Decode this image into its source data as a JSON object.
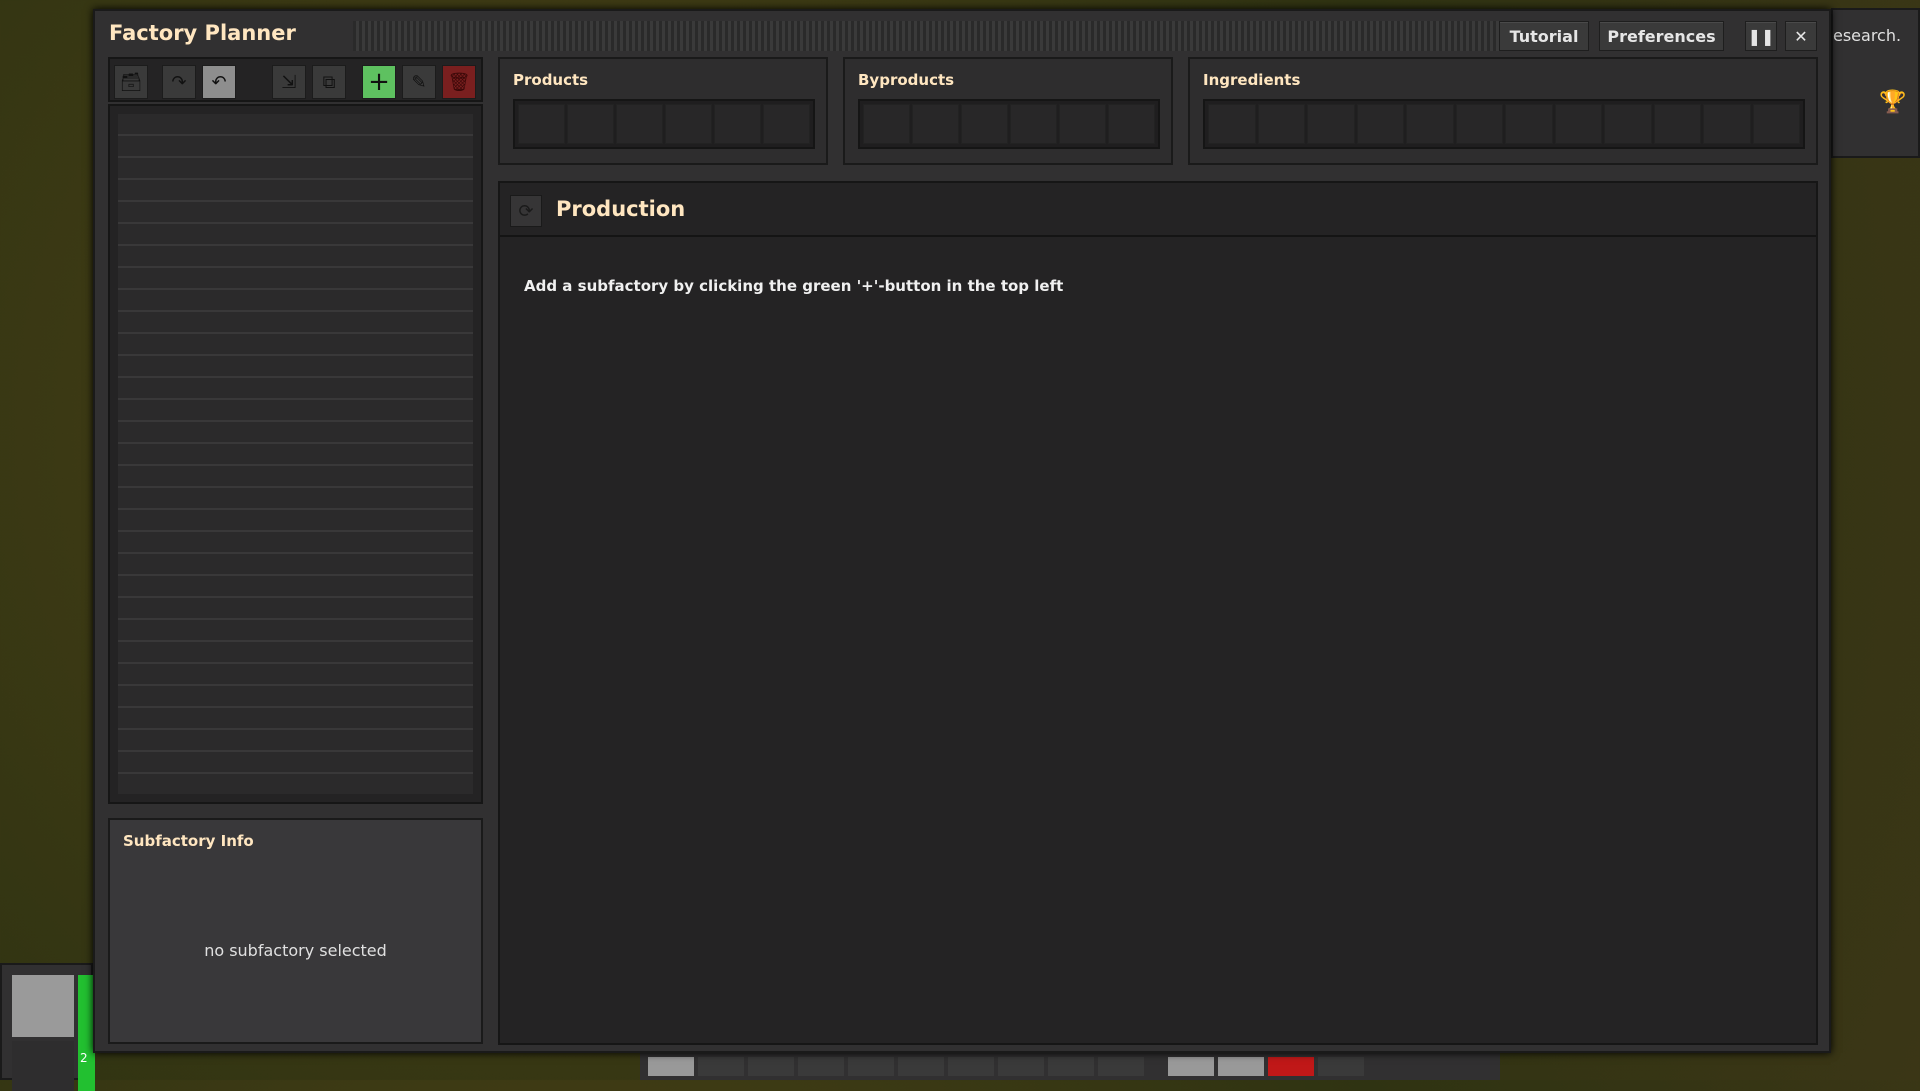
{
  "window": {
    "title": "Factory Planner",
    "tutorial_label": "Tutorial",
    "preferences_label": "Preferences"
  },
  "toolbar": {
    "icons": [
      "archive-icon",
      "redo-icon",
      "undo-icon",
      "import-icon",
      "duplicate-icon",
      "add-icon",
      "edit-icon",
      "delete-icon"
    ],
    "add_color": "#5ec160",
    "delete_color": "#7a1f1f"
  },
  "subfactory_info": {
    "title": "Subfactory Info",
    "empty_text": "no subfactory selected"
  },
  "item_boxes": {
    "products": "Products",
    "byproducts": "Byproducts",
    "ingredients": "Ingredients"
  },
  "production": {
    "title": "Production",
    "hint": "Add a subfactory by clicking the green '+'-button in the top left"
  },
  "background_ui": {
    "research_text": "esearch.",
    "ammo_count": "2"
  }
}
